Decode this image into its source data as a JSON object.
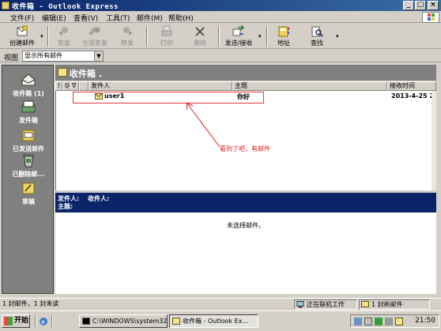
{
  "window": {
    "title": "收件箱 - Outlook Express",
    "controls": {
      "minimize": "_",
      "maximize": "□",
      "close": "×"
    }
  },
  "menu": [
    "文件(F)",
    "编辑(E)",
    "查看(V)",
    "工具(T)",
    "邮件(M)",
    "帮助(H)"
  ],
  "toolbar": {
    "items": [
      {
        "label": "创建邮件",
        "icon": "new-mail-icon",
        "enabled": true,
        "dropdown": true
      },
      {
        "label": "答复",
        "icon": "reply-icon",
        "enabled": false
      },
      {
        "label": "全部答复",
        "icon": "reply-all-icon",
        "enabled": false
      },
      {
        "label": "转发",
        "icon": "forward-icon",
        "enabled": false
      },
      {
        "label": "打印",
        "icon": "print-icon",
        "enabled": false
      },
      {
        "label": "删除",
        "icon": "delete-icon",
        "enabled": false
      },
      {
        "label": "发送/接收",
        "icon": "send-receive-icon",
        "enabled": true,
        "dropdown": true
      },
      {
        "label": "地址",
        "icon": "address-book-icon",
        "enabled": true
      },
      {
        "label": "查找",
        "icon": "find-icon",
        "enabled": true,
        "dropdown": true
      }
    ]
  },
  "viewbar": {
    "label": "视图",
    "selected": "显示所有邮件"
  },
  "outlook_bar": {
    "items": [
      {
        "label": "收件箱 (1)",
        "icon": "inbox-icon"
      },
      {
        "label": "发件箱",
        "icon": "outbox-icon"
      },
      {
        "label": "已发送邮件",
        "icon": "sent-items-icon"
      },
      {
        "label": "已删除邮...",
        "icon": "deleted-items-icon"
      },
      {
        "label": "草稿",
        "icon": "drafts-icon"
      }
    ]
  },
  "list": {
    "title": "收件箱 .",
    "columns": [
      "!",
      "0",
      "∇",
      "发件人",
      "主题",
      "接收时间"
    ],
    "rows": [
      {
        "from": "user1",
        "subject": "你好",
        "received": "2013-4-25 2",
        "unread": true
      }
    ]
  },
  "annotation": "看到了吧，有邮件",
  "preview": {
    "from_label": "发件人:",
    "to_label": "收件人:",
    "subject_label": "主题:",
    "empty_text": "未选择邮件。"
  },
  "status": {
    "counts": "1 封邮件，1 封未读",
    "connection": "正在联机工作",
    "new_mail": "1 封新邮件"
  },
  "taskbar": {
    "start": "开始",
    "tasks": [
      {
        "label": "C:\\WINDOWS\\system32...",
        "active": false
      },
      {
        "label": "收件箱 - Outlook Ex...",
        "active": true
      }
    ],
    "clock": "21:50"
  },
  "colors": {
    "titlebar": "#0a246a",
    "annotation": "#e02020",
    "preview_header": "#0a246a",
    "outlook_bar": "#808080"
  }
}
